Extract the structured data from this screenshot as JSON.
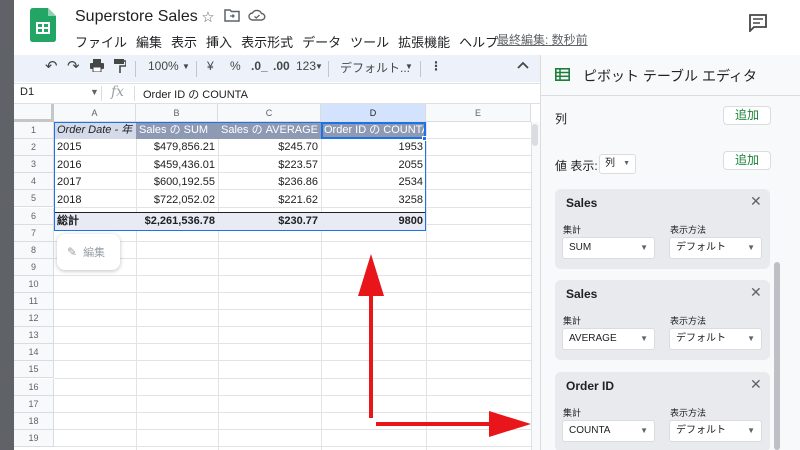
{
  "app": {
    "title": "Superstore Sales",
    "menu": [
      "ファイル",
      "編集",
      "表示",
      "挿入",
      "表示形式",
      "データ",
      "ツール",
      "拡張機能",
      "ヘルプ"
    ],
    "last_edit": "最終編集: 数秒前"
  },
  "toolbar": {
    "zoom": "100%",
    "currency": "¥",
    "percent": "%",
    "dec_decrease": ".0_",
    "dec_increase": ".00",
    "format_123": "123",
    "font": "デフォルト...",
    "more": "⋮"
  },
  "formula_bar": {
    "cell_ref": "D1",
    "fx": "fx",
    "content": "Order ID の COUNTA"
  },
  "sheet": {
    "columns": [
      "A",
      "B",
      "C",
      "D",
      "E"
    ],
    "rows": [
      "1",
      "2",
      "3",
      "4",
      "5",
      "6",
      "7",
      "8",
      "9",
      "10",
      "11",
      "12",
      "13",
      "14",
      "15",
      "16",
      "17",
      "18",
      "19"
    ],
    "header": [
      "Order Date - 年",
      "Sales の SUM",
      "Sales の AVERAGE",
      "Order ID の COUNTA"
    ],
    "data": [
      [
        "2015",
        "$479,856.21",
        "$245.70",
        "1953"
      ],
      [
        "2016",
        "$459,436.01",
        "$223.57",
        "2055"
      ],
      [
        "2017",
        "$600,192.55",
        "$236.86",
        "2534"
      ],
      [
        "2018",
        "$722,052.02",
        "$221.62",
        "3258"
      ]
    ],
    "total": [
      "総計",
      "$2,261,536.78",
      "$230.77",
      "9800"
    ],
    "edit_chip": "編集"
  },
  "panel": {
    "title": "ピボット テーブル エディタ",
    "columns_label": "列",
    "add_label": "追加",
    "values_label": "値 表示:",
    "values_display": "列",
    "agg_label": "集計",
    "display_label": "表示方法",
    "cards": [
      {
        "field": "Sales",
        "agg": "SUM",
        "display": "デフォルト"
      },
      {
        "field": "Sales",
        "agg": "AVERAGE",
        "display": "デフォルト"
      },
      {
        "field": "Order ID",
        "agg": "COUNTA",
        "display": "デフォルト"
      }
    ]
  },
  "colors": {
    "accent_green": "#188038",
    "arrow_red": "#e8151b",
    "pivot_header": "#8e9ab3",
    "selection_blue": "#1a73e8"
  }
}
